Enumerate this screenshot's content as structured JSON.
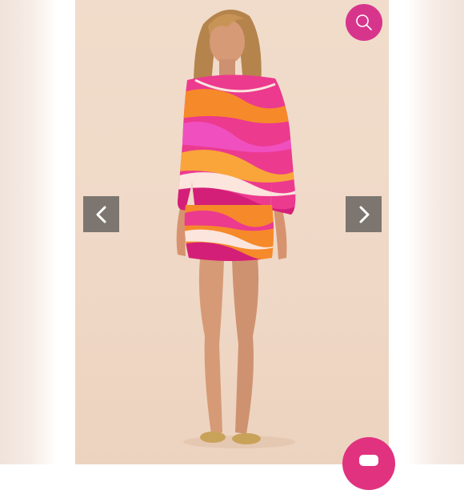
{
  "gallery": {
    "image_subject": "",
    "zoom_button": {
      "icon": "search-icon",
      "color": "#d7358c"
    },
    "prev_button": {
      "icon": "chevron-left-icon"
    },
    "next_button": {
      "icon": "chevron-right-icon"
    },
    "chat_button": {
      "icon": "chat-bubble-icon",
      "color": "#e0327f"
    }
  }
}
